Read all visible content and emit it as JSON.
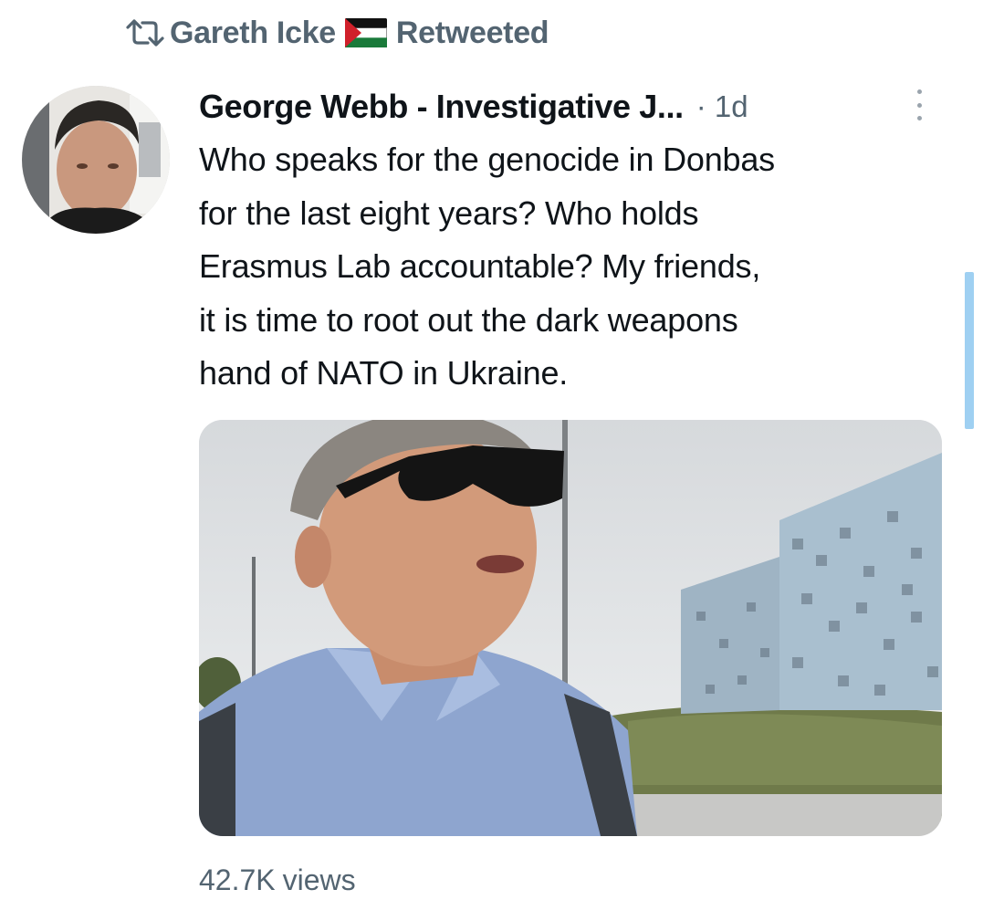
{
  "retweet": {
    "icon": "retweet-icon",
    "user": "Gareth Icke",
    "flag": "palestine-flag-emoji",
    "label": "Retweeted"
  },
  "tweet": {
    "author": "George Webb - Investigative J...",
    "separator": "·",
    "time": "1d",
    "lines": [
      "Who speaks for the genocide in Donbas",
      "for the last eight years?  Who holds",
      "Erasmus Lab accountable?  My friends,",
      "it is time to root out the dark weapons",
      "hand of NATO in Ukraine."
    ],
    "views_count": "42.7K",
    "views_label": "views"
  },
  "colors": {
    "secondary_text": "#536471",
    "primary_text": "#0f1419",
    "scroll_indicator": "#9fd0f2"
  }
}
